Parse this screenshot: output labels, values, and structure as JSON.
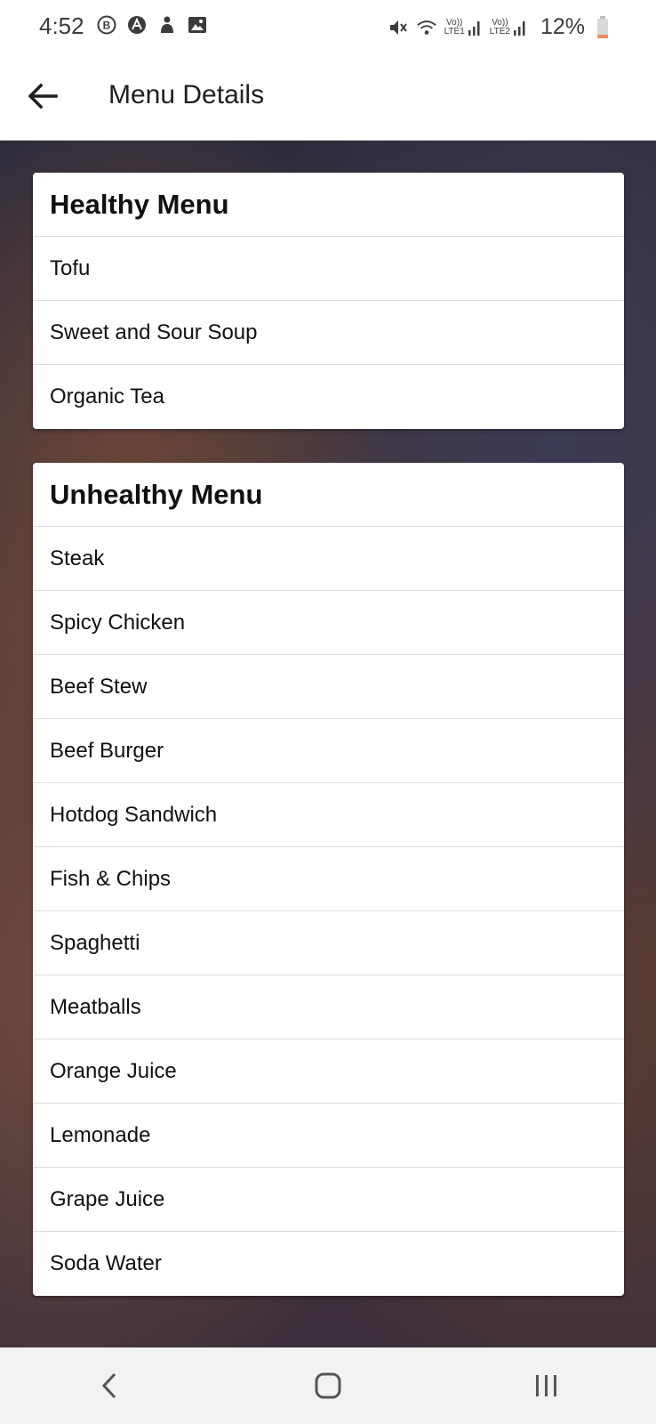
{
  "status_bar": {
    "time": "4:52",
    "battery": "12%",
    "lte1": "LTE1",
    "lte2": "LTE2",
    "volte": "Vo))"
  },
  "app_bar": {
    "title": "Menu Details",
    "back_icon": "arrow-left-icon"
  },
  "healthy_menu": {
    "title": "Healthy Menu",
    "items": [
      "Tofu",
      "Sweet and Sour Soup",
      "Organic Tea"
    ]
  },
  "unhealthy_menu": {
    "title": "Unhealthy Menu",
    "items": [
      "Steak",
      "Spicy Chicken",
      "Beef Stew",
      "Beef Burger",
      "Hotdog Sandwich",
      "Fish & Chips",
      "Spaghetti",
      "Meatballs",
      "Orange Juice",
      "Lemonade",
      "Grape Juice",
      "Soda Water"
    ]
  },
  "nav_bar": {
    "back_icon": "nav-back-icon",
    "home_icon": "nav-home-icon",
    "recents_icon": "nav-recents-icon"
  },
  "colors": {
    "accent_battery": "#f08a5d",
    "text": "#111111"
  }
}
